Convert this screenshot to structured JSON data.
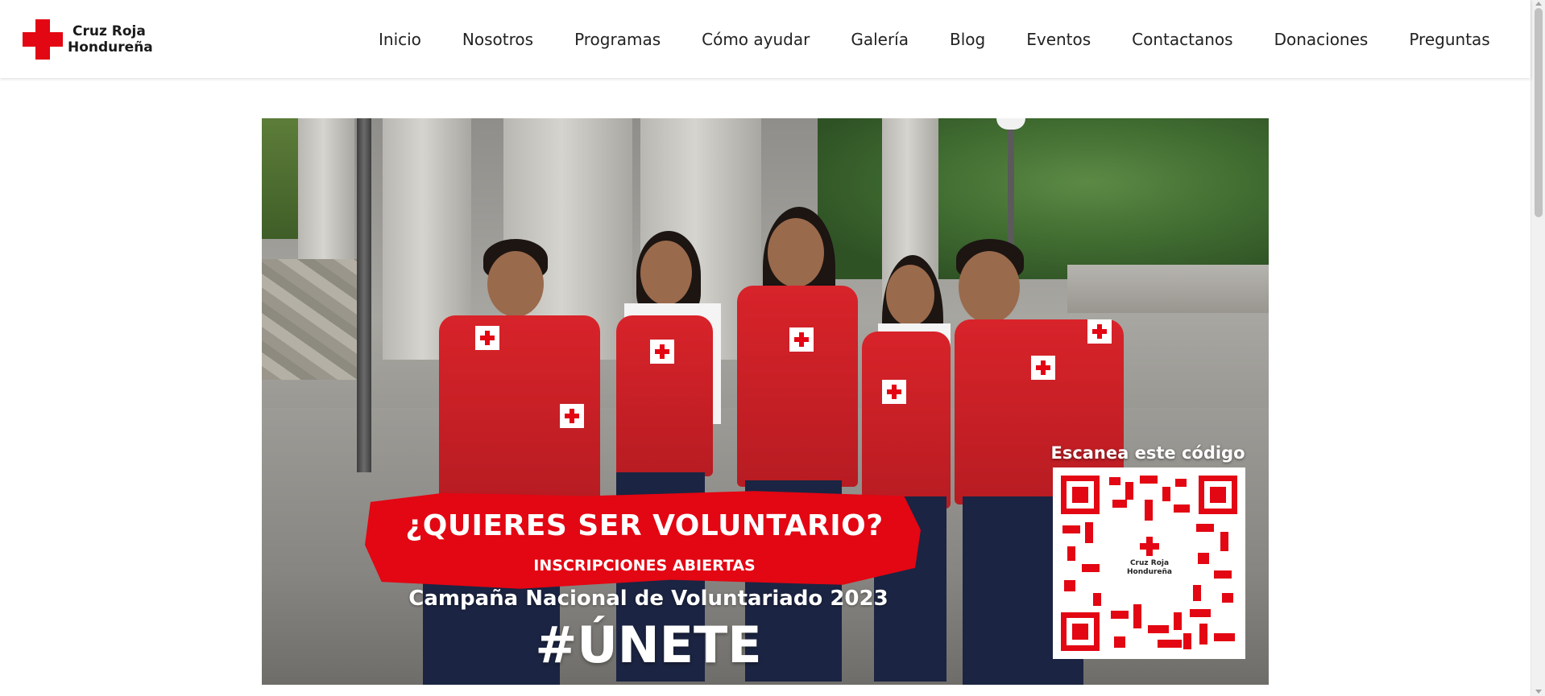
{
  "brand": {
    "name_line1": "Cruz Roja",
    "name_line2": "Hondureña",
    "logo_icon": "red-cross-icon",
    "accent_color": "#e30613"
  },
  "nav": {
    "items": [
      {
        "label": "Inicio"
      },
      {
        "label": "Nosotros"
      },
      {
        "label": "Programas"
      },
      {
        "label": "Cómo ayudar"
      },
      {
        "label": "Galería"
      },
      {
        "label": "Blog"
      },
      {
        "label": "Eventos"
      },
      {
        "label": "Contactanos"
      },
      {
        "label": "Donaciones"
      },
      {
        "label": "Preguntas"
      }
    ]
  },
  "banner": {
    "headline": "¿QUIERES SER VOLUNTARIO?",
    "subline": "INSCRIPCIONES ABIERTAS",
    "campaign": "Campaña Nacional de Voluntariado 2023",
    "hashtag": "#ÚNETE",
    "qr_label": "Escanea este código",
    "qr_center_line1": "Cruz Roja",
    "qr_center_line2": "Hondureña"
  }
}
